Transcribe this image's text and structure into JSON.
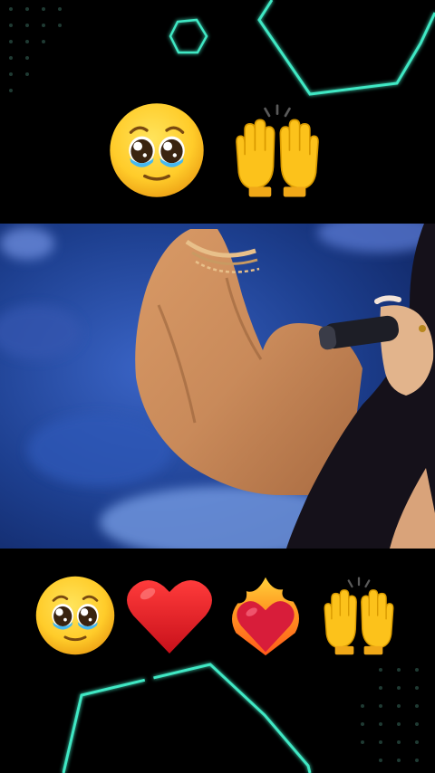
{
  "top_emojis": [
    "pleading-face-emoji",
    "raising-hands-emoji"
  ],
  "bottom_emojis": [
    "pleading-face-emoji",
    "red-heart-emoji",
    "heart-on-fire-emoji",
    "raising-hands-emoji"
  ],
  "video": {
    "scene": "singer-with-microphone",
    "background_color": "#1d3f8f",
    "sleeve_color": "#c98a5a",
    "hair_color": "#15111a"
  },
  "decoration": {
    "accent_color": "#3fe8c4"
  }
}
